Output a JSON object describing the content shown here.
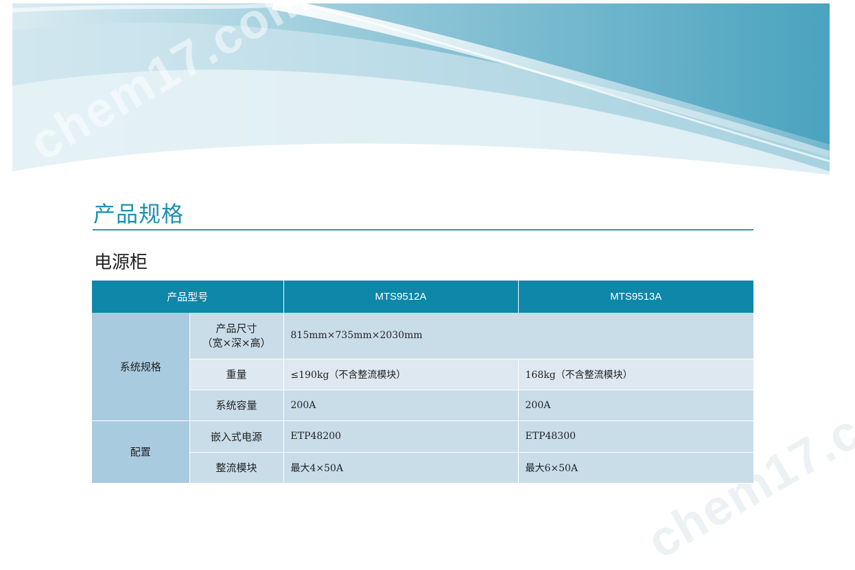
{
  "watermarks": [
    "chem17.com",
    "chem17.com"
  ],
  "heading": "产品规格",
  "subheading": "电源柜",
  "table": {
    "header": {
      "model_label": "产品型号",
      "col1": "MTS9512A",
      "col2": "MTS9513A"
    },
    "groups": [
      {
        "name": "系统规格",
        "rows": [
          {
            "label_line1": "产品尺寸",
            "label_line2": "（宽×深×高）",
            "shared_value": "815mm×735mm×2030mm"
          },
          {
            "label": "重量",
            "v1": "≤190kg（不含整流模块）",
            "v2": "168kg（不含整流模块）"
          },
          {
            "label": "系统容量",
            "v1": "200A",
            "v2": "200A"
          }
        ]
      },
      {
        "name": "配置",
        "rows": [
          {
            "label": "嵌入式电源",
            "v1": "ETP48200",
            "v2": "ETP48300"
          },
          {
            "label": "整流模块",
            "v1": "最大4×50A",
            "v2": "最大6×50A"
          }
        ]
      }
    ]
  },
  "colors": {
    "accent": "#0e87a9",
    "title": "#1f8fb0",
    "group_bg": "#a9cbdf",
    "row_bg": "#c9dde9",
    "row_alt_bg": "#dde8f0"
  }
}
